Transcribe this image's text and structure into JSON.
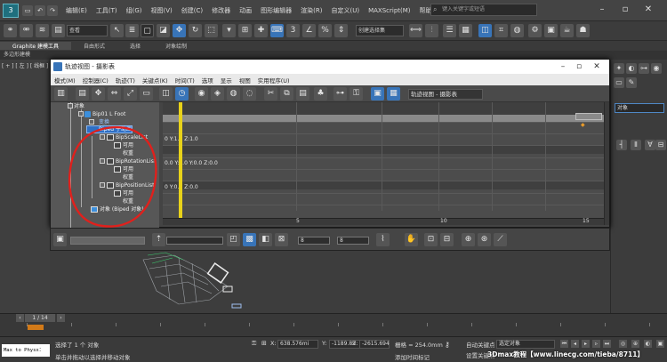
{
  "app": {
    "menus": [
      "编辑(E)",
      "工具(T)",
      "组(G)",
      "视图(V)",
      "创建(C)",
      "修改器",
      "动画",
      "图形编辑器",
      "渲染(R)",
      "自定义(U)",
      "MAXScript(M)",
      "帮助(H)"
    ],
    "search_placeholder": "键入关键字或短语",
    "layer_value": "查看",
    "selection_set_value": "创建选择集",
    "ribbon_tabs": [
      "Graphite 建模工具",
      "自由形式",
      "选择",
      "对象绘制"
    ],
    "ribbon_sub": "多边形建模",
    "viewport_label": "[ + ] [ 左 ] [ 线框 ]",
    "command_field": "对象"
  },
  "trackview": {
    "title": "轨迹视图 - 摄影表",
    "menus": [
      "模式(M)",
      "控制器(C)",
      "轨迹(T)",
      "关键点(K)",
      "时间(T)",
      "选项",
      "显示",
      "视图",
      "实用程序(U)"
    ],
    "name_field": "轨迹视图 - 摄影表",
    "tree": {
      "objects": "对象",
      "bip_node": "Bip01 L Foot",
      "transform": "变换",
      "sub_anim": "Biped 子动画",
      "scale_list": "BipScaleList",
      "rotation_list": "BipRotationList",
      "position_list": "BipPositionList",
      "available": "可用",
      "weight": "权重",
      "biped_object": "对象 (Biped 对象)"
    },
    "graph_labels": {
      "scale": "0 Y:1.0 Z:1.0",
      "rotation": "0.0 Y:0.0 Y:0.0 Z:0.0",
      "position": "0 Y:0.0 Z:0.0"
    },
    "ruler_numbers": [
      "5",
      "10",
      "15"
    ],
    "bottom_field_1": "8",
    "bottom_field_2": "8"
  },
  "timeline": {
    "frame_counter": "1 / 14"
  },
  "status": {
    "maxscript": "Max to Physx：",
    "selected": "选择了 1 个 对象",
    "prompt": "单击并拖动以选择并移动对象",
    "x_label": "X:",
    "x_value": "638.576mi",
    "y_label": "Y:",
    "y_value": "-1189.89",
    "z_label": "Z:",
    "z_value": "-2615.694",
    "grid": "栅格 = 254.0mm",
    "add_time_tag": "添加时间标记",
    "auto_key": "自动关键点",
    "set_key": "设置关键点",
    "key_filter": "选定对象",
    "watermark": "3Dmax教程【www.linecg.com/tieba/8711】"
  }
}
